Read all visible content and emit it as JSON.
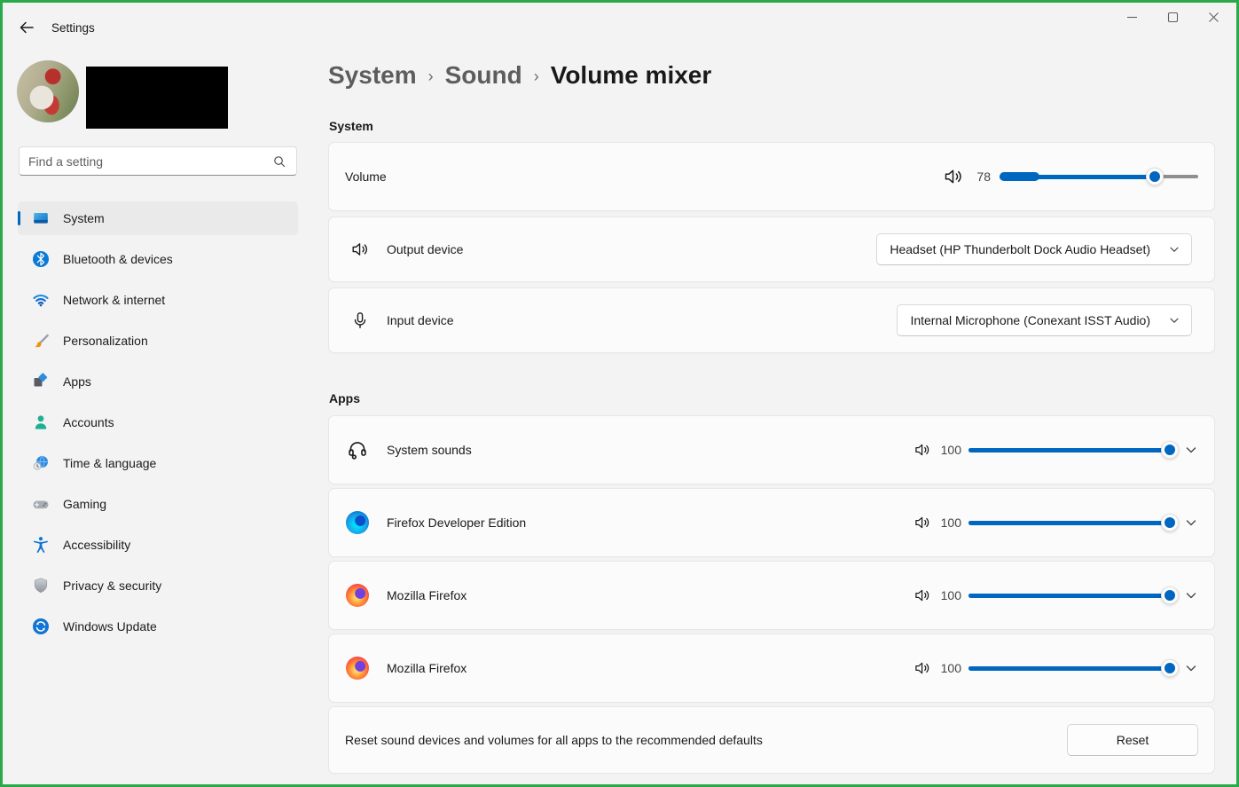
{
  "colors": {
    "accent": "#0067c0",
    "share_border": "#2aa84a"
  },
  "titlebar": {
    "app_title": "Settings",
    "back_icon": "back-arrow-icon",
    "controls": [
      "minimize-icon",
      "maximize-icon",
      "close-icon"
    ]
  },
  "sidebar": {
    "profile": {
      "avatar": "user-avatar-photo",
      "name_redacted": true
    },
    "search": {
      "placeholder": "Find a setting",
      "icon": "search-icon"
    },
    "items": [
      {
        "label": "System",
        "icon": "system-icon",
        "selected": true
      },
      {
        "label": "Bluetooth & devices",
        "icon": "bluetooth-icon",
        "selected": false
      },
      {
        "label": "Network & internet",
        "icon": "network-icon",
        "selected": false
      },
      {
        "label": "Personalization",
        "icon": "personalization-icon",
        "selected": false
      },
      {
        "label": "Apps",
        "icon": "apps-icon",
        "selected": false
      },
      {
        "label": "Accounts",
        "icon": "accounts-icon",
        "selected": false
      },
      {
        "label": "Time & language",
        "icon": "time-language-icon",
        "selected": false
      },
      {
        "label": "Gaming",
        "icon": "gaming-icon",
        "selected": false
      },
      {
        "label": "Accessibility",
        "icon": "accessibility-icon",
        "selected": false
      },
      {
        "label": "Privacy & security",
        "icon": "privacy-icon",
        "selected": false
      },
      {
        "label": "Windows Update",
        "icon": "windows-update-icon",
        "selected": false
      }
    ]
  },
  "breadcrumb": {
    "items": [
      "System",
      "Sound",
      "Volume mixer"
    ],
    "separator": "›"
  },
  "system_section": {
    "header": "System",
    "volume_row": {
      "label": "Volume",
      "icon": "speaker-icon",
      "value": 78,
      "max": 100,
      "meter_percent": 20
    },
    "output_row": {
      "label": "Output device",
      "icon": "speaker-icon",
      "selected_option": "Headset (HP Thunderbolt Dock Audio Headset)",
      "chevron": "chevron-down-icon"
    },
    "input_row": {
      "label": "Input device",
      "icon": "microphone-icon",
      "selected_option": "Internal Microphone (Conexant ISST Audio)",
      "chevron": "chevron-down-icon"
    }
  },
  "apps_section": {
    "header": "Apps",
    "rows": [
      {
        "app": "System sounds",
        "icon": "headset-icon",
        "volume": 100
      },
      {
        "app": "Firefox Developer Edition",
        "icon": "firefox-developer-icon",
        "volume": 100
      },
      {
        "app": "Mozilla Firefox",
        "icon": "firefox-icon",
        "volume": 100
      },
      {
        "app": "Mozilla Firefox",
        "icon": "firefox-icon",
        "volume": 100
      }
    ]
  },
  "reset_section": {
    "description": "Reset sound devices and volumes for all apps to the recommended defaults",
    "button_label": "Reset"
  }
}
